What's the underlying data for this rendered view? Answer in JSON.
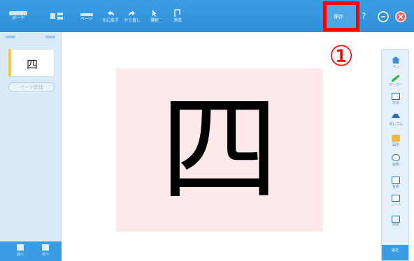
{
  "toolbar": {
    "items": [
      {
        "label": "ボード",
        "icon": "board-icon"
      },
      {
        "label": "",
        "icon": "layout-icon"
      },
      {
        "label": "ページ",
        "icon": "pages-icon"
      },
      {
        "label": "元に戻す",
        "icon": "undo-icon"
      },
      {
        "label": "やり直し",
        "icon": "redo-icon"
      },
      {
        "label": "選択",
        "icon": "select-icon"
      },
      {
        "label": "消去",
        "icon": "erase-icon"
      }
    ],
    "highlighted_label": "保存"
  },
  "marker": "①",
  "left_panel": {
    "thumbnail_char": "四",
    "add_page_label": "ページ追加",
    "bottom_buttons": [
      {
        "label": "前へ",
        "icon": "prev-page-icon"
      },
      {
        "label": "次へ",
        "icon": "next-page-icon"
      }
    ]
  },
  "canvas": {
    "character": "四",
    "background": "#fde8ea"
  },
  "right_toolbar": {
    "items": [
      {
        "label": "ペン",
        "icon": "home-icon"
      },
      {
        "label": "マーカー",
        "icon": "pen-icon"
      },
      {
        "label": "文字",
        "icon": "text-icon"
      },
      {
        "label": "消しゴム",
        "icon": "eraser-icon"
      },
      {
        "label": "図形",
        "icon": "folder-icon"
      },
      {
        "label": "画像",
        "icon": "image-icon"
      },
      {
        "label": "背景",
        "icon": "background-icon"
      },
      {
        "label": "ノート",
        "icon": "note-icon"
      },
      {
        "label": "PDF",
        "icon": "pdf-icon"
      }
    ],
    "bottom_label": "設定"
  },
  "colors": {
    "toolbar_blue": "#3a9de3",
    "highlight_red": "#ff0000",
    "canvas_pink": "#fde8ea",
    "panel_blue": "#d8ebf7"
  }
}
